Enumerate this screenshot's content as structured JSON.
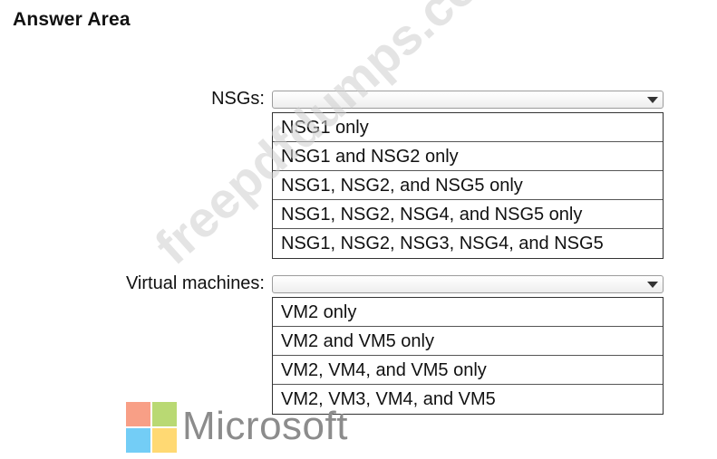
{
  "title": "Answer Area",
  "nsgs": {
    "label": "NSGs:",
    "selected": "",
    "options": [
      "NSG1 only",
      "NSG1 and NSG2 only",
      "NSG1, NSG2, and NSG5 only",
      "NSG1, NSG2, NSG4, and NSG5 only",
      "NSG1, NSG2, NSG3, NSG4, and NSG5"
    ]
  },
  "vms": {
    "label": "Virtual machines:",
    "selected": "",
    "options": [
      "VM2 only",
      "VM2 and VM5 only",
      "VM2, VM4, and VM5 only",
      "VM2, VM3, VM4, and VM5"
    ]
  },
  "logo": {
    "text": "Microsoft",
    "colors": [
      "#f25022",
      "#7fba00",
      "#00a4ef",
      "#ffb900"
    ]
  },
  "watermark": "freepdfdumps.com"
}
